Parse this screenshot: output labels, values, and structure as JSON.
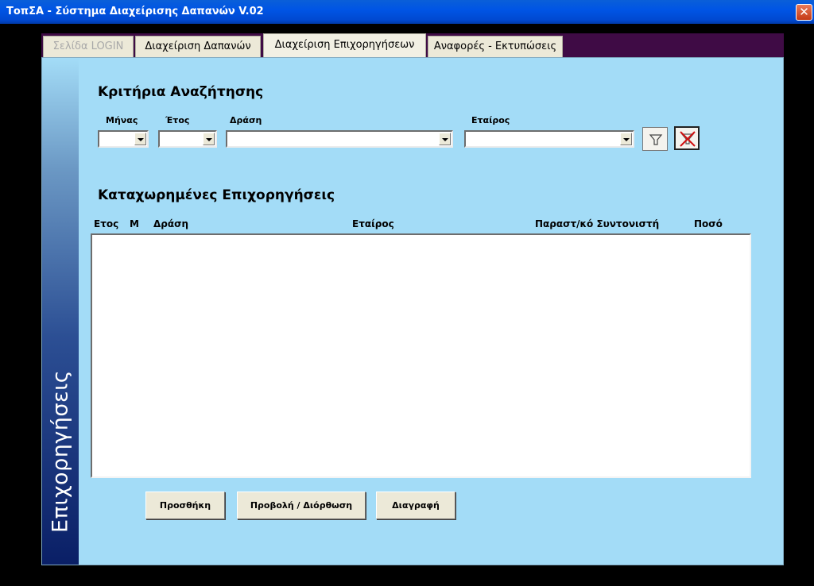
{
  "window": {
    "title": "ΤοπΣΑ - Σύστημα Διαχείρισης Δαπανών   V.02",
    "close_glyph": "✕"
  },
  "tabs": [
    {
      "label": "Σελίδα LOGIN",
      "state": "disabled"
    },
    {
      "label": "Διαχείριση Δαπανών",
      "state": "normal"
    },
    {
      "label": "Διαχείριση Επιχορηγήσεων",
      "state": "active"
    },
    {
      "label": "Αναφορές - Εκτυπώσεις",
      "state": "normal"
    }
  ],
  "sidebar": {
    "label": "Επιχορηγήσεις"
  },
  "search": {
    "title": "Κριτήρια Αναζήτησης",
    "month_label": "Μήνας",
    "year_label": "Έτος",
    "action_label": "Δράση",
    "partner_label": "Εταίρος",
    "month_value": "",
    "year_value": "",
    "action_value": "",
    "partner_value": "",
    "filter_icon": "funnel-icon",
    "clear_icon": "clear-filter-icon"
  },
  "list": {
    "title": "Καταχωρημένες Επιχορηγήσεις",
    "columns": [
      "Ετος",
      "Μ",
      "Δράση",
      "Εταίρος",
      "Παραστ/κό Συντονιστή",
      "Ποσό"
    ],
    "rows": []
  },
  "buttons": {
    "add": "Προσθήκη",
    "view_edit": "Προβολή / Διόρθωση",
    "delete": "Διαγραφή"
  },
  "colors": {
    "panel_bg": "#a3dcf7",
    "tab_strip": "#3f0b45",
    "titlebar": "#0055e5"
  }
}
